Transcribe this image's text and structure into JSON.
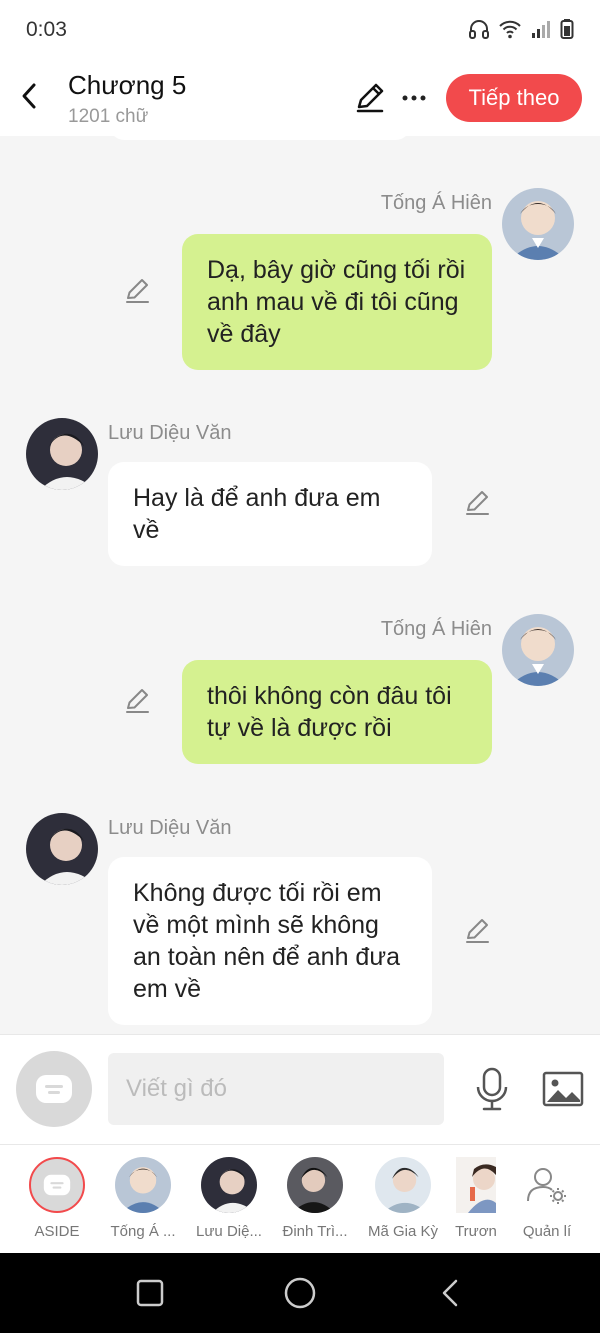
{
  "status_bar": {
    "time": "0:03",
    "icons": [
      "headphones-icon",
      "wifi-icon",
      "signal-icon",
      "battery-icon"
    ]
  },
  "header": {
    "title": "Chương 5",
    "word_count": "1201 chữ",
    "next_label": "Tiếp theo",
    "accent_color": "#f24a4c"
  },
  "messages": [
    {
      "speaker": "Tống Á Hiên",
      "side": "right",
      "text": "Dạ, bây giờ cũng tối rồi anh mau về đi tôi cũng về đây"
    },
    {
      "speaker": "Lưu Diệu Văn",
      "side": "left",
      "text": "Hay là để anh đưa em về"
    },
    {
      "speaker": "Tống Á Hiên",
      "side": "right",
      "text": "thôi không còn đâu tôi tự về là được rồi"
    },
    {
      "speaker": "Lưu Diệu Văn",
      "side": "left",
      "text": "Không được tối rồi em về một mình sẽ không an toàn nên để anh đưa em về"
    }
  ],
  "composer": {
    "placeholder": "Viết gì đó"
  },
  "characters": [
    {
      "label": "ASIDE"
    },
    {
      "label": "Tống Á ..."
    },
    {
      "label": "Lưu Diệ..."
    },
    {
      "label": "Đinh Trì..."
    },
    {
      "label": "Mã Gia Kỳ"
    },
    {
      "label": "Trươn"
    },
    {
      "label": "Quản lí"
    }
  ],
  "colors": {
    "right_bubble": "#d5f190",
    "left_bubble": "#ffffff",
    "background": "#f5f5f5"
  }
}
